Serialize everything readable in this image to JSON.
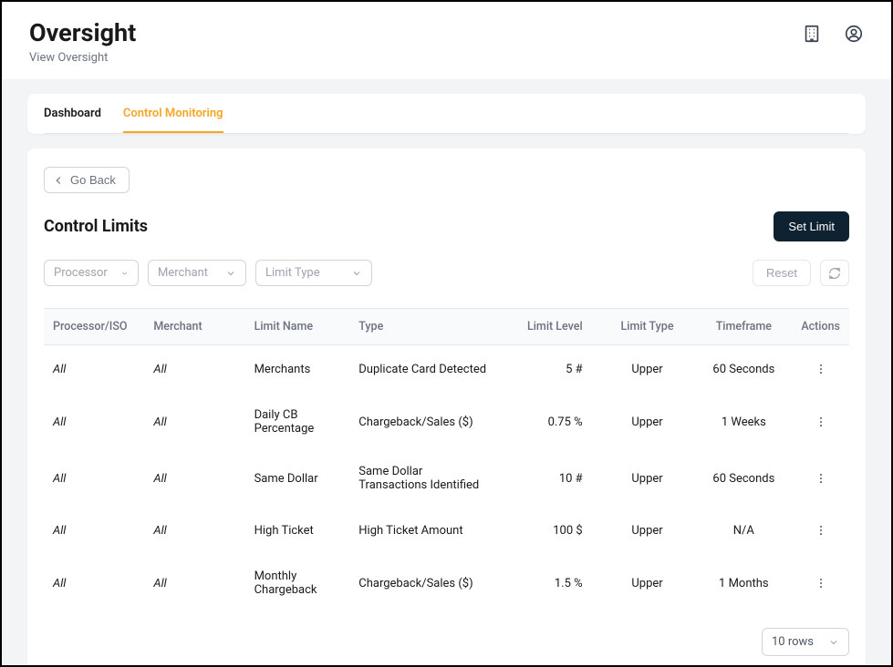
{
  "header": {
    "title": "Oversight",
    "subtitle": "View Oversight"
  },
  "tabs": [
    {
      "label": "Dashboard",
      "active": false
    },
    {
      "label": "Control Monitoring",
      "active": true
    }
  ],
  "buttons": {
    "go_back": "Go Back",
    "set_limit": "Set Limit",
    "reset": "Reset"
  },
  "section": {
    "title": "Control Limits"
  },
  "filters": {
    "processor": "Processor",
    "merchant": "Merchant",
    "limit_type": "Limit Type"
  },
  "table": {
    "columns": {
      "processor": "Processor/ISO",
      "merchant": "Merchant",
      "limit_name": "Limit Name",
      "type": "Type",
      "limit_level": "Limit Level",
      "limit_type": "Limit Type",
      "timeframe": "Timeframe",
      "actions": "Actions"
    },
    "rows": [
      {
        "processor": "All",
        "merchant": "All",
        "limit_name": "Merchants",
        "type": "Duplicate Card Detected",
        "limit_level": "5 #",
        "limit_type": "Upper",
        "timeframe": "60 Seconds"
      },
      {
        "processor": "All",
        "merchant": "All",
        "limit_name": "Daily CB Percentage",
        "type": "Chargeback/Sales ($)",
        "limit_level": "0.75 %",
        "limit_type": "Upper",
        "timeframe": "1 Weeks"
      },
      {
        "processor": "All",
        "merchant": "All",
        "limit_name": "Same Dollar",
        "type": "Same Dollar Transactions Identified",
        "limit_level": "10 #",
        "limit_type": "Upper",
        "timeframe": "60 Seconds"
      },
      {
        "processor": "All",
        "merchant": "All",
        "limit_name": "High Ticket",
        "type": "High Ticket Amount",
        "limit_level": "100 $",
        "limit_type": "Upper",
        "timeframe": "N/A"
      },
      {
        "processor": "All",
        "merchant": "All",
        "limit_name": "Monthly Chargeback",
        "type": "Chargeback/Sales ($)",
        "limit_level": "1.5 %",
        "limit_type": "Upper",
        "timeframe": "1 Months"
      }
    ]
  },
  "pagination": {
    "rows_label": "10 rows"
  }
}
